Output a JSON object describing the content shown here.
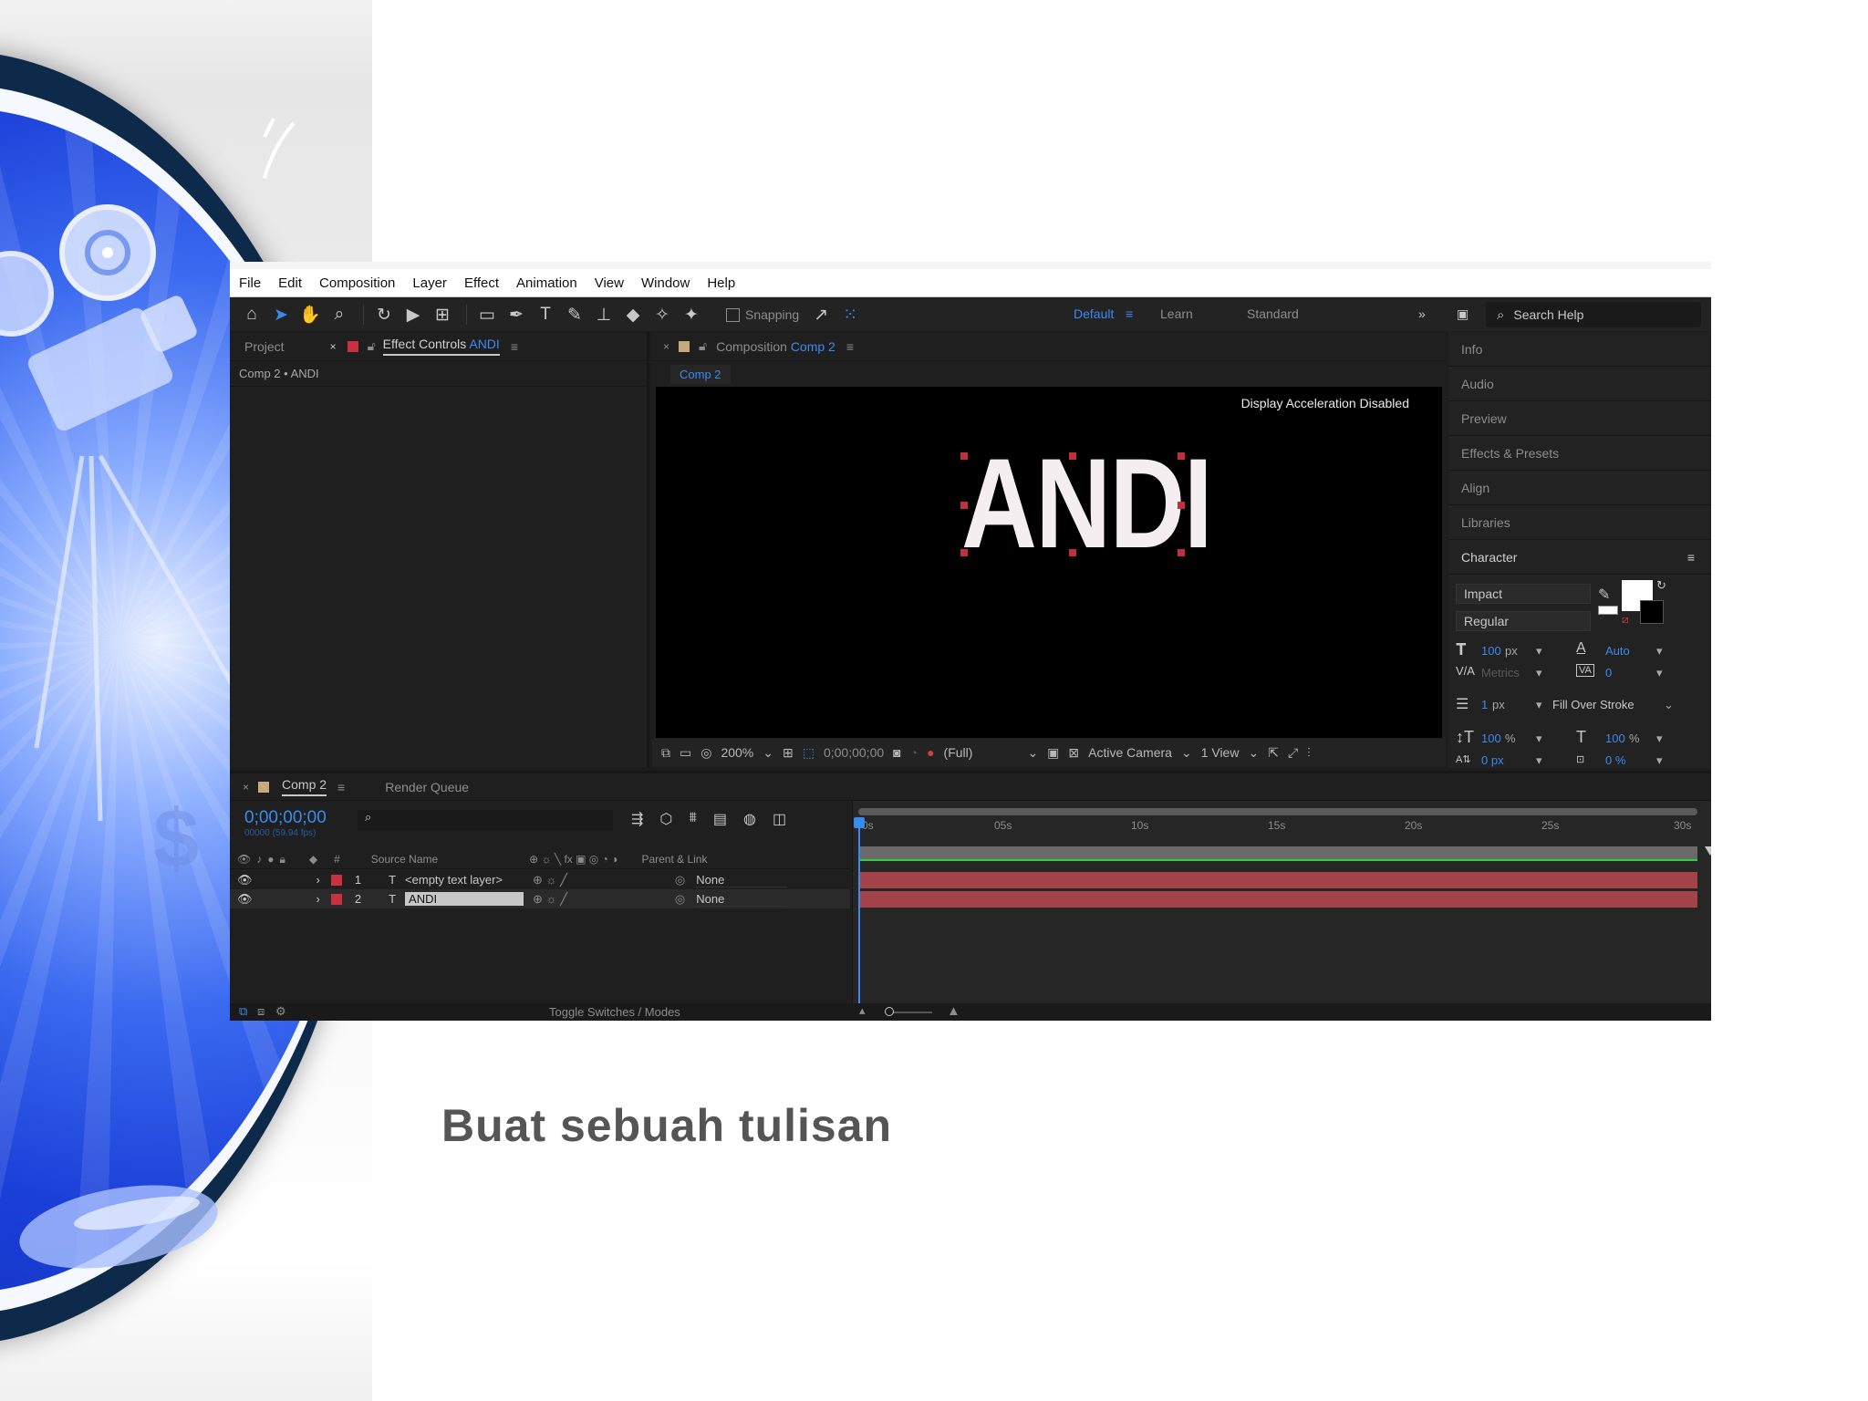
{
  "menu": [
    "File",
    "Edit",
    "Composition",
    "Layer",
    "Effect",
    "Animation",
    "View",
    "Window",
    "Help"
  ],
  "toolbar": {
    "snapping_label": "Snapping",
    "workspaces": [
      "Default",
      "Learn",
      "Standard"
    ],
    "active_workspace": "Default",
    "search_label": "Search Help"
  },
  "left_panel": {
    "project_tab": "Project",
    "effect_controls_prefix": "Effect Controls",
    "effect_controls_target": "ANDI",
    "subtitle": "Comp 2 • ANDI"
  },
  "composition_panel": {
    "tab_prefix": "Composition",
    "tab_name": "Comp 2",
    "breadcrumb": "Comp 2",
    "notice": "Display Acceleration Disabled",
    "canvas_text": "ANDI",
    "zoom": "200%",
    "timecode": "0;00;00;00",
    "resolution": "(Full)",
    "camera": "Active Camera",
    "views": "1 View"
  },
  "side_panels": [
    "Info",
    "Audio",
    "Preview",
    "Effects & Presets",
    "Align",
    "Libraries"
  ],
  "character": {
    "title": "Character",
    "font": "Impact",
    "style": "Regular",
    "size": "100",
    "size_unit": "px",
    "leading": "Auto",
    "kerning": "Metrics",
    "tracking": "0",
    "stroke_width": "1",
    "stroke_unit": "px",
    "stroke_type": "Fill Over Stroke",
    "vscale": "100",
    "hscale": "100",
    "pct": "%",
    "baseline": "0 px",
    "tsume": "0 %",
    "fill_color": "#ffffff",
    "stroke_color": "#000000"
  },
  "timeline": {
    "comp_tab": "Comp 2",
    "render_queue_tab": "Render Queue",
    "timecode": "0;00;00;00",
    "frame_info": "00000 (59.94 fps)",
    "col_source": "Source Name",
    "col_parent": "Parent & Link",
    "ruler": [
      "0s",
      "05s",
      "10s",
      "15s",
      "20s",
      "25s",
      "30s"
    ],
    "layers": [
      {
        "num": "1",
        "name": "<empty text layer>",
        "parent": "None"
      },
      {
        "num": "2",
        "name": "ANDI",
        "parent": "None"
      }
    ],
    "toggle_label": "Toggle Switches / Modes"
  },
  "caption": "Buat sebuah tulisan"
}
